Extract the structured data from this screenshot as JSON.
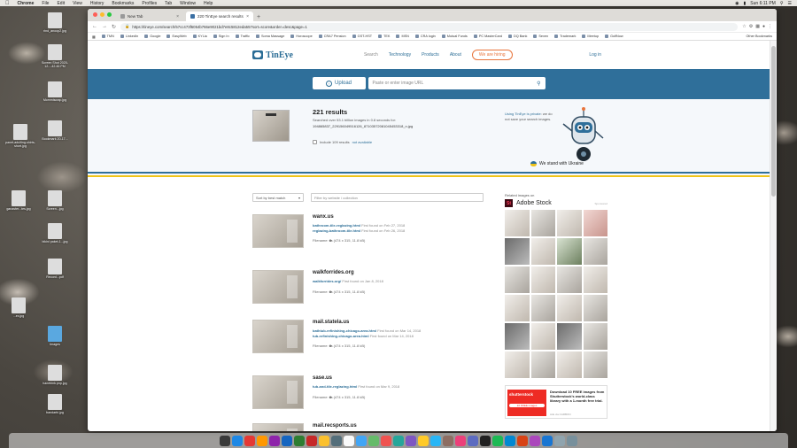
{
  "menubar": {
    "items": [
      "Chrome",
      "File",
      "Edit",
      "View",
      "History",
      "Bookmarks",
      "Profiles",
      "Tab",
      "Window",
      "Help"
    ],
    "clock": "Sun 6:11 PM"
  },
  "desktop_icons": [
    {
      "label": "rind_anoop2.jpg"
    },
    {
      "label": "Screen Shot 2020-12...-42.46 PM"
    },
    {
      "label": "Mommiscrap.jpg"
    },
    {
      "label": "panet-adulting-shirts-short.jpg"
    },
    {
      "label": "Bookmark 20-17..."
    },
    {
      "label": "ganaster...tes.jpg"
    },
    {
      "label": "Screen...jpg"
    },
    {
      "label": "bikini paket-1...jpg"
    },
    {
      "label": "Record...pdf"
    },
    {
      "label": "...ex.jpg"
    },
    {
      "label": "Images"
    },
    {
      "label": "hanebink.pnp.jpg"
    },
    {
      "label": "bandarbi.jpg"
    }
  ],
  "browser": {
    "tabs": [
      {
        "title": "New Tab",
        "active": false
      },
      {
        "title": "220 TinEye search results",
        "active": true
      }
    ],
    "url": "https://tineye.com/search/57cc473f6054b766e9021bd7e8c5812eda557sort=score&order=desc&page=1",
    "bookmarks": [
      "TMN",
      "LinkedIn",
      "Google",
      "EasyWeb",
      "KYLia",
      "Sign In",
      "Traffic",
      "Soma Massage",
      "Horoscope",
      "CRA7 Pension",
      "GST-HST",
      "TEK",
      "MSN",
      "CRA login",
      "Mutual Funds",
      "PC MasterCard",
      "DQ Bank",
      "Seven",
      "Trademark",
      "Meetup",
      "GolfNow"
    ],
    "other_bookmarks": "Other Bookmarks"
  },
  "tineye": {
    "brand": "TinEye",
    "nav": {
      "search": "Search",
      "technology": "Technology",
      "products": "Products",
      "about": "About",
      "hiring": "We are hiring",
      "login": "Log in"
    },
    "upload_label": "Upload",
    "url_placeholder": "Paste or enter image URL",
    "results_count": "221 results",
    "results_sub": "Searched over 53.1 billion images in 0.8 seconds for:",
    "results_file": "194865837_229156049516126_87103572081045453318_n.jpg",
    "include_label": "Include 109 results",
    "include_na": "not available",
    "private_link": "Using TinEye is private",
    "private_text": ": we do not save your search images.",
    "ukraine": "We stand with Ukraine",
    "sort_label": "Sort by best match",
    "filter_placeholder": "Filter by website / collection",
    "results": [
      {
        "domain": "wanx.us",
        "links": [
          {
            "url": "bathroom-tile-reglazing.html",
            "found": "First found on Feb 27, 2018"
          },
          {
            "url": "reglazing-bathroom-tile.html",
            "found": "First found on Feb 26, 2018"
          }
        ],
        "filename_label": "Filename:",
        "filename": "th",
        "meta": "(474 x 315, 11.8 kB)"
      },
      {
        "domain": "walkforrides.org",
        "links": [
          {
            "url": "walkforrides.org/",
            "found": "First found on Jan 8, 2018"
          }
        ],
        "filename_label": "Filename:",
        "filename": "th",
        "meta": "(474 x 315, 11.8 kB)"
      },
      {
        "domain": "mail.statela.us",
        "links": [
          {
            "url": "bathtub-refinishing-chicago-area.html",
            "found": "First found on Mar 14, 2018"
          },
          {
            "url": "tub-refinishing-chicago-area.html",
            "found": "First found on Mar 14, 2018"
          }
        ],
        "filename_label": "Filename:",
        "filename": "th",
        "meta": "(474 x 315, 11.8 kB)"
      },
      {
        "domain": "sase.us",
        "links": [
          {
            "url": "tub-and-tile-reglazing.html",
            "found": "First found on Mar 9, 2018"
          }
        ],
        "filename_label": "Filename:",
        "filename": "th",
        "meta": "(474 x 315, 11.8 kB)"
      },
      {
        "domain": "mail.recsports.us",
        "links": [],
        "filename_label": "",
        "filename": "",
        "meta": ""
      }
    ],
    "sidebar": {
      "title": "Related images on",
      "adobe": "Adobe Stock",
      "adobe_mark": "St",
      "sponsored": "Sponsored",
      "shutter_logo": "shutterstock",
      "shutter_badge": "10 FREE images",
      "shutter_text": "Download 10 FREE images from Shutterstock's world-class library with a 1-month free trial.",
      "ads_by": "Ads via CARBON"
    }
  }
}
